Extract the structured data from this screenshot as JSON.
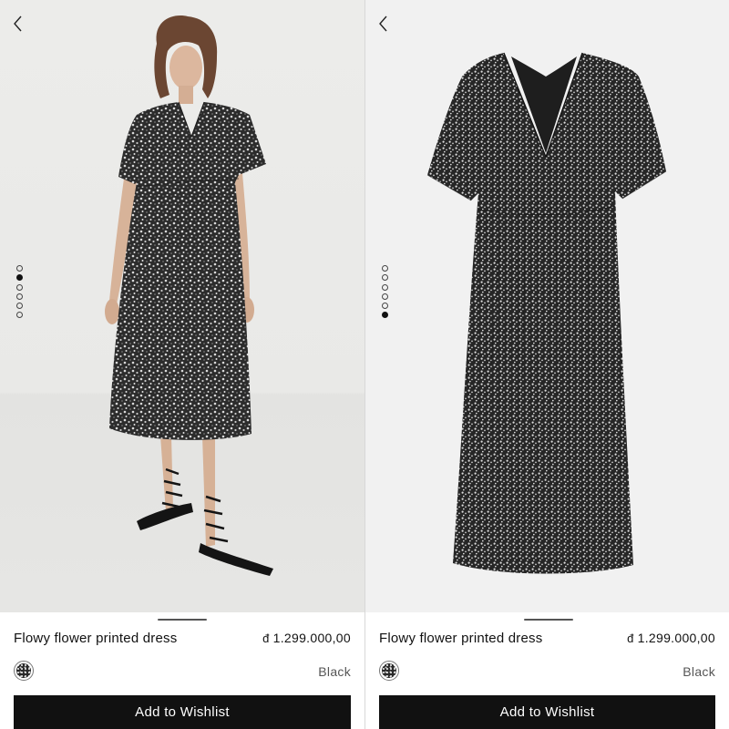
{
  "colors": {
    "button_bg": "#111111",
    "button_text": "#ffffff",
    "text": "#111111",
    "muted": "#555555"
  },
  "panels": [
    {
      "icons": {
        "back": "chevron-left-icon"
      },
      "gallery": {
        "image_count": 6,
        "active_index": 1,
        "image": "model-wearing-dress"
      },
      "product": {
        "name": "Flowy flower printed dress",
        "currency_symbol": "đ",
        "price": "1.299.000,00"
      },
      "color": {
        "swatch": "dark-floral-print",
        "name": "Black"
      },
      "button": {
        "label": "Add to Wishlist"
      }
    },
    {
      "icons": {
        "back": "chevron-left-icon"
      },
      "gallery": {
        "image_count": 6,
        "active_index": 5,
        "image": "dress-flat-product-shot"
      },
      "product": {
        "name": "Flowy flower printed dress",
        "currency_symbol": "đ",
        "price": "1.299.000,00"
      },
      "color": {
        "swatch": "dark-floral-print",
        "name": "Black"
      },
      "button": {
        "label": "Add to Wishlist"
      }
    }
  ]
}
